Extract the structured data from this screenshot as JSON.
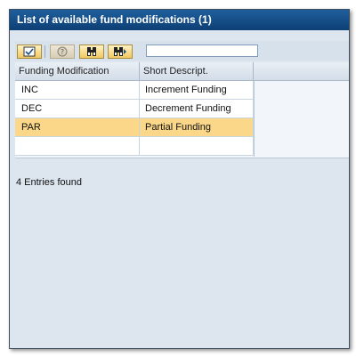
{
  "window": {
    "title": "List of available fund modifications (1)"
  },
  "toolbar": {
    "buttons": [
      {
        "icon": "choose-icon",
        "enabled": true
      },
      {
        "icon": "help-icon",
        "enabled": false
      },
      {
        "icon": "find-icon",
        "enabled": true
      },
      {
        "icon": "find-next-icon",
        "enabled": true
      }
    ],
    "search_value": ""
  },
  "table": {
    "columns": [
      "Funding Modification",
      "Short Descript."
    ],
    "rows": [
      {
        "code": "INC",
        "description": "Increment Funding",
        "selected": false
      },
      {
        "code": "DEC",
        "description": "Decrement Funding",
        "selected": false
      },
      {
        "code": "PAR",
        "description": "Partial Funding",
        "selected": true
      }
    ]
  },
  "status": {
    "text": "4 Entries found"
  },
  "colors": {
    "title_bar": "#1f5f9c",
    "selected_row": "#fbd78a",
    "dialog_background": "#dde6ef"
  }
}
